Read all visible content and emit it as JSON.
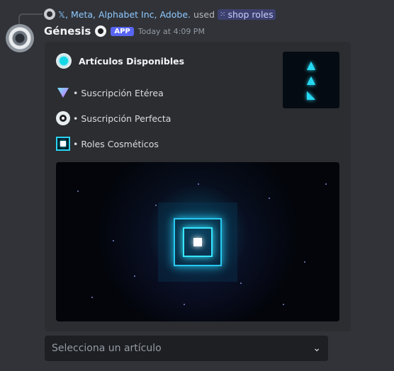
{
  "reply": {
    "names": "𝕏, Meta, Alphabet Inc, Adobe.",
    "used": "used",
    "command": "shop roles"
  },
  "message": {
    "username": "Génesis",
    "badge": "APP",
    "timestamp": "Today at 4:09 PM"
  },
  "embed": {
    "title": "Artículos Disponibles",
    "items": [
      {
        "label": "• Suscripción Etérea",
        "icon": "etherea-icon"
      },
      {
        "label": "• Suscripción Perfecta",
        "icon": "perfect-circle-icon"
      },
      {
        "label": "• Roles Cosméticos",
        "icon": "cosmetic-square-icon"
      }
    ]
  },
  "select": {
    "placeholder": "Selecciona un artículo"
  },
  "colors": {
    "background": "#313338",
    "embed": "#2b2d31",
    "accent": "#5865f2",
    "cyan": "#12d7e7"
  }
}
